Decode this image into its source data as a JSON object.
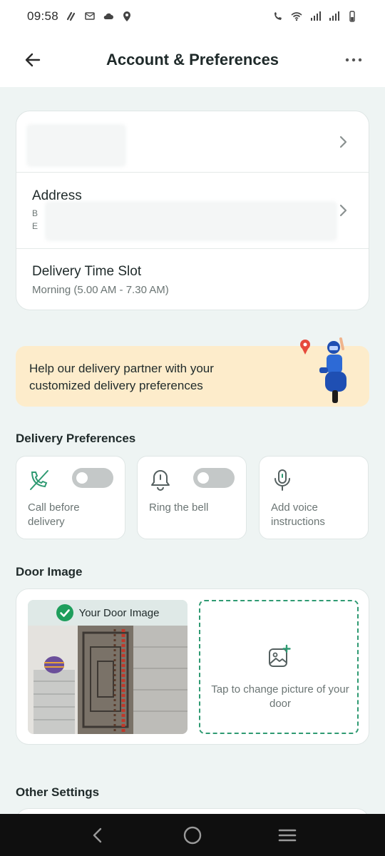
{
  "status_bar": {
    "time": "09:58"
  },
  "header": {
    "title": "Account & Preferences"
  },
  "account": {
    "address_label": "Address",
    "address_line1": "B",
    "address_line2": "E",
    "delivery_slot_label": "Delivery Time Slot",
    "delivery_slot_value": "Morning (5.00 AM - 7.30 AM)"
  },
  "promo": {
    "text": "Help our delivery partner with your customized delivery preferences"
  },
  "delivery_preferences": {
    "title": "Delivery Preferences",
    "items": [
      {
        "label": "Call before delivery",
        "toggle": false
      },
      {
        "label": "Ring the bell",
        "toggle": false
      },
      {
        "label": "Add voice instructions"
      }
    ]
  },
  "door_image": {
    "title": "Door Image",
    "badge_text": "Your Door Image",
    "upload_text": "Tap to change picture of your door"
  },
  "other_settings": {
    "title": "Other Settings"
  },
  "colors": {
    "accent_green": "#2f9a72",
    "promo_bg": "#fdeccb",
    "page_bg": "#eef4f3"
  }
}
